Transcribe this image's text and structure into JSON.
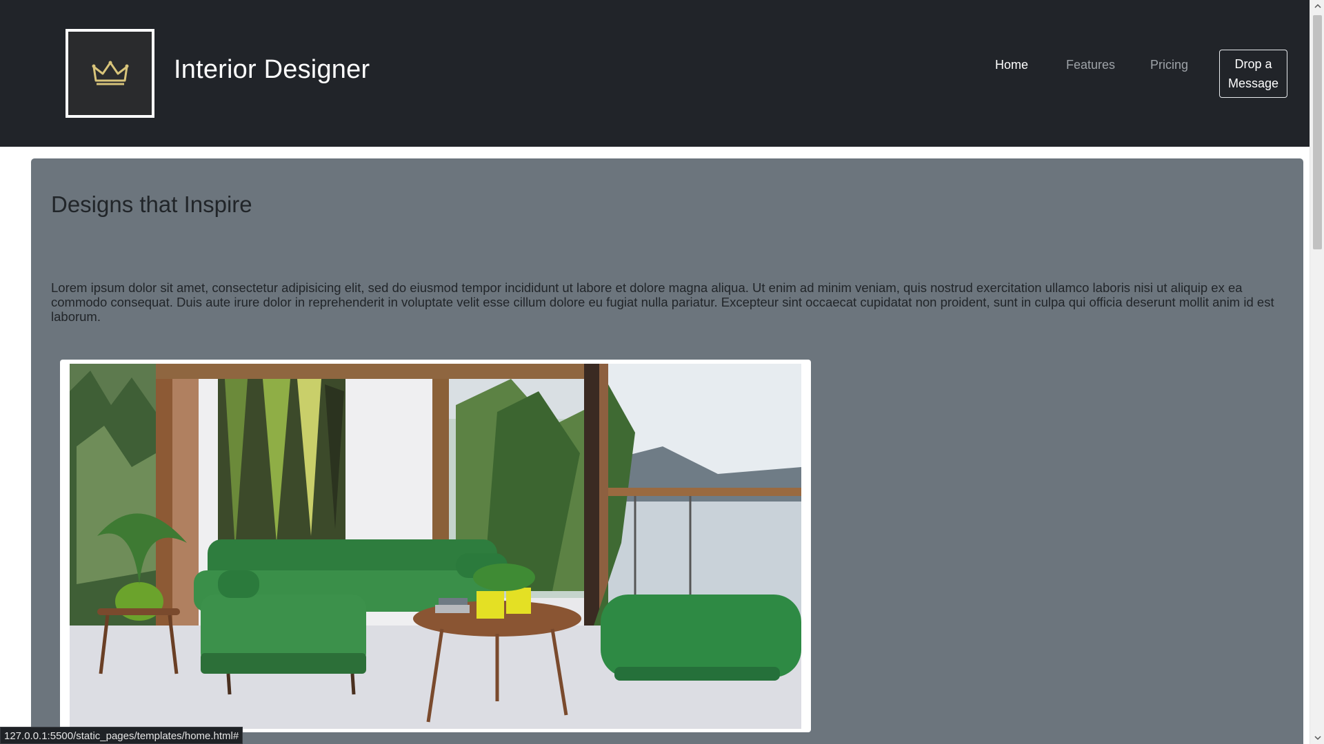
{
  "navbar": {
    "logo_icon": "crown-icon",
    "brand": "Interior Designer",
    "links": [
      {
        "label": "Home",
        "active": true
      },
      {
        "label": "Features",
        "active": false
      },
      {
        "label": "Pricing",
        "active": false
      }
    ],
    "cta_label": "Drop a Message"
  },
  "main": {
    "title": "Designs that Inspire",
    "body": "Lorem ipsum dolor sit amet, consectetur adipisicing elit, sed do eiusmod tempor incididunt ut labore et dolore magna aliqua. Ut enim ad minim veniam, quis nostrud exercitation ullamco laboris nisi ut aliquip ex ea commodo consequat. Duis aute irure dolor in reprehenderit in voluptate velit esse cillum dolore eu fugiat nulla pariatur. Excepteur sint occaecat cupidatat non proident, sunt in culpa qui officia deserunt mollit anim id est laborum.",
    "image_subject": "living-room-green-velvet-sofa"
  },
  "status_url": "127.0.0.1:5500/static_pages/templates/home.html#",
  "colors": {
    "navbar_bg": "#212429",
    "panel_bg": "#6c757d",
    "crown_gold": "#d8c47a",
    "sofa_green": "#2e7d3e"
  }
}
